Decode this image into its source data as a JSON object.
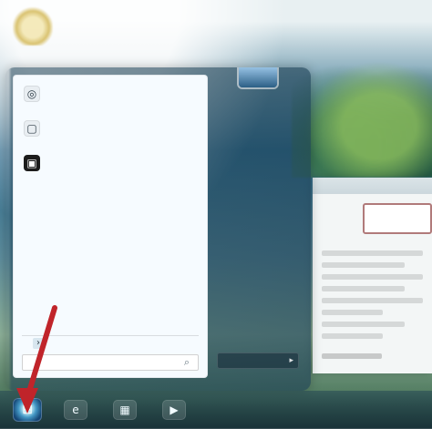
{
  "colors": {
    "arrow": "#c0242a",
    "menu_left_bg": "#f6fbff"
  },
  "desktop": {
    "icon": "desktop-app-icon"
  },
  "start_menu": {
    "recent_items": [
      {
        "icon": "globe-icon",
        "title": "",
        "subtitle": ""
      },
      {
        "icon": "blank-doc-icon",
        "title": "",
        "subtitle": ""
      },
      {
        "icon": "terminal-icon",
        "title": "",
        "subtitle": ""
      }
    ],
    "all_programs_label": "",
    "search_placeholder": "",
    "right_links": [
      "",
      "",
      "",
      "",
      "",
      "",
      "",
      "",
      "",
      "",
      ""
    ],
    "shutdown_label": ""
  },
  "background_window": {
    "highlight_text": ""
  },
  "taskbar": {
    "start_icon": "windows-logo-icon",
    "pinned": [
      "internet-explorer-icon",
      "file-explorer-icon",
      "media-player-icon"
    ]
  }
}
